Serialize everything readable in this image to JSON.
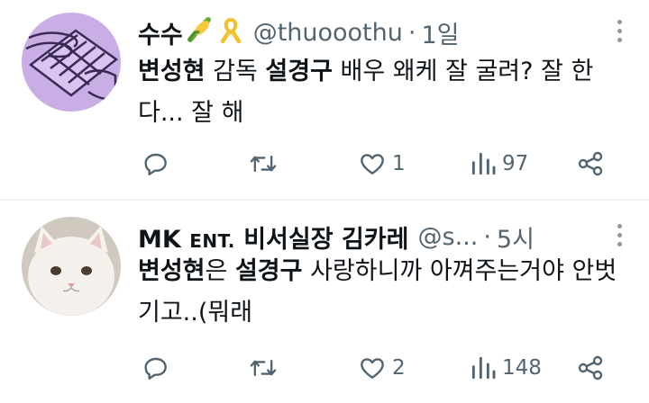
{
  "tweets": [
    {
      "display_name": "수수",
      "emoji": [
        "corn-emoji",
        "yellow-ribbon-emoji"
      ],
      "handle": "@thuooothu",
      "separator": "·",
      "time": "1일",
      "body": [
        {
          "text": "변성현",
          "bold": true
        },
        {
          "text": " 감독 ",
          "bold": false
        },
        {
          "text": "설경구",
          "bold": true
        },
        {
          "text": " 배우 왜케 잘 굴려? 잘 한다... 잘 해",
          "bold": false
        }
      ],
      "replies": "",
      "retweets": "",
      "likes": "1",
      "views": "97"
    },
    {
      "display_name_main": "MK ",
      "display_name_smallcaps": "ENT.",
      "display_name_rest": " 비서실장 김카레",
      "handle": "@s...",
      "separator": "·",
      "time": "5시",
      "body": [
        {
          "text": "변성현",
          "bold": true
        },
        {
          "text": "은 ",
          "bold": false
        },
        {
          "text": "설경구",
          "bold": true
        },
        {
          "text": " 사랑하니까 아껴주는거야 안벗기고..(뭐래",
          "bold": false
        }
      ],
      "replies": "",
      "retweets": "",
      "likes": "2",
      "views": "148"
    }
  ],
  "colors": {
    "text": "#0f1419",
    "secondary": "#536471",
    "divider": "#eff3f4",
    "avatar1_bg": "#c9aee6",
    "avatar2_bg": "#cfc9c0"
  }
}
